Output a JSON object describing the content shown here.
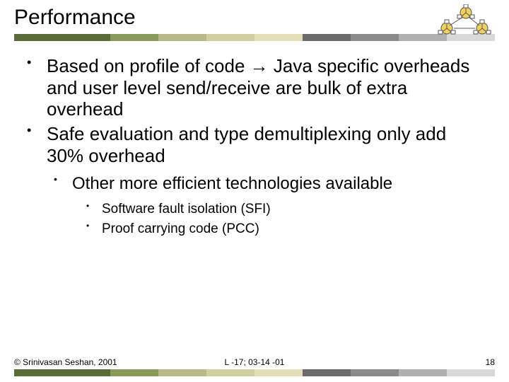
{
  "slide": {
    "title": "Performance",
    "bullets_l1": [
      "Based on profile of code → Java specific overheads and user level send/receive are bulk of extra overhead",
      "Safe evaluation and type demultiplexing only add 30% overhead"
    ],
    "bullets_l2": [
      "Other more efficient technologies available"
    ],
    "bullets_l3": [
      "Software fault isolation (SFI)",
      "Proof carrying code (PCC)"
    ]
  },
  "footer": {
    "copyright": "© Srinivasan Seshan, 2001",
    "lecture": "L -17; 03-14 -01",
    "page": "18"
  },
  "palette": {
    "bar": [
      "#5a6b3a",
      "#5a6b3a",
      "#8a9a5b",
      "#b7b98b",
      "#d0cfa0",
      "#e2dfb8",
      "#6b6b6b",
      "#8a8a8a",
      "#b0b0b0",
      "#d9d9d9"
    ]
  }
}
